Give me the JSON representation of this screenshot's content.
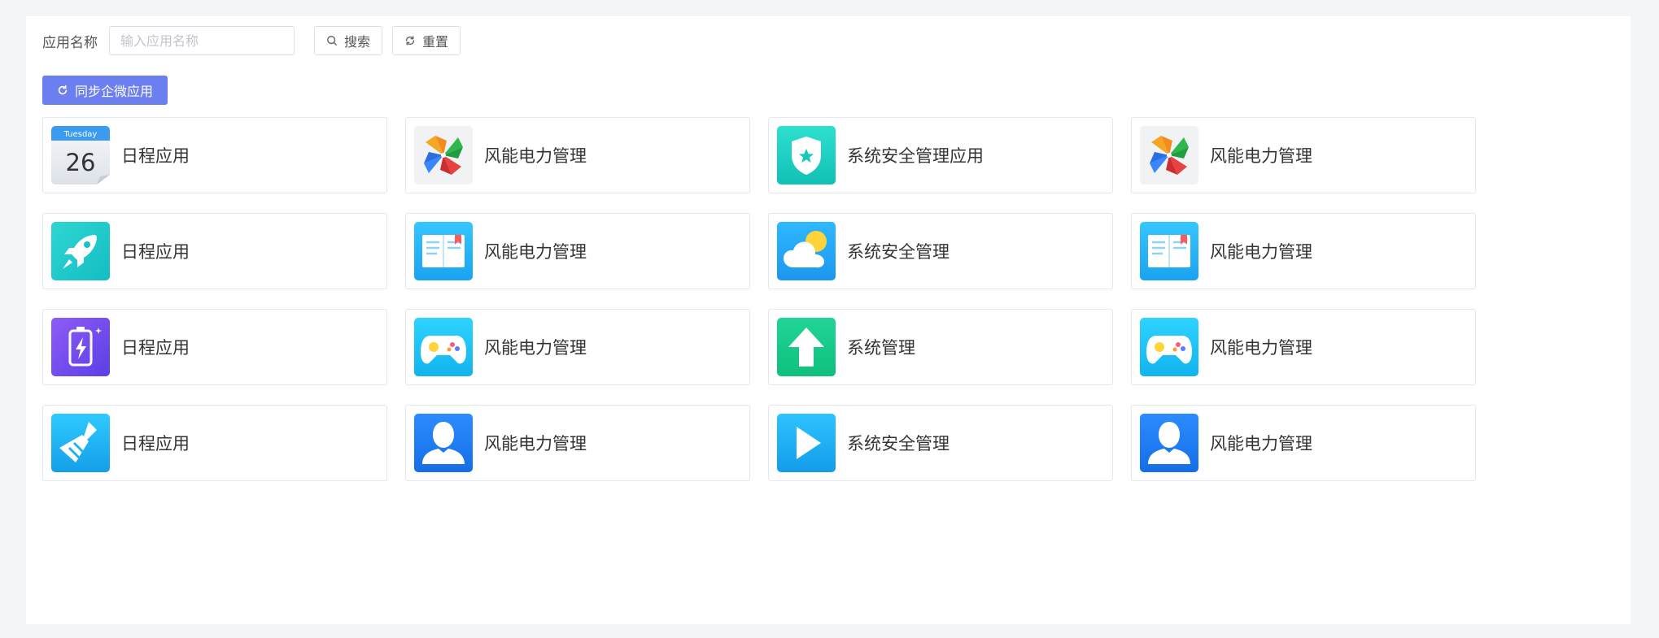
{
  "search": {
    "label": "应用名称",
    "placeholder": "输入应用名称",
    "value": "",
    "search_button": "搜索",
    "reset_button": "重置"
  },
  "sync_button": "同步企微应用",
  "calendar_icon": {
    "weekday": "Tuesday",
    "day": "26"
  },
  "apps": [
    {
      "name": "日程应用",
      "icon": "calendar-icon"
    },
    {
      "name": "风能电力管理",
      "icon": "pinwheel-icon"
    },
    {
      "name": "系统安全管理应用",
      "icon": "shield-icon"
    },
    {
      "name": "风能电力管理",
      "icon": "pinwheel-icon"
    },
    {
      "name": "日程应用",
      "icon": "rocket-icon"
    },
    {
      "name": "风能电力管理",
      "icon": "book-icon"
    },
    {
      "name": "系统安全管理",
      "icon": "weather-icon"
    },
    {
      "name": "风能电力管理",
      "icon": "book-icon"
    },
    {
      "name": "日程应用",
      "icon": "battery-icon"
    },
    {
      "name": "风能电力管理",
      "icon": "gamepad-icon"
    },
    {
      "name": "系统管理",
      "icon": "arrow-up-icon"
    },
    {
      "name": "风能电力管理",
      "icon": "gamepad-icon"
    },
    {
      "name": "日程应用",
      "icon": "broom-icon"
    },
    {
      "name": "风能电力管理",
      "icon": "user-icon"
    },
    {
      "name": "系统安全管理",
      "icon": "play-icon"
    },
    {
      "name": "风能电力管理",
      "icon": "user-icon"
    }
  ],
  "colors": {
    "primary": "#6b7ff0",
    "border": "#e4e7ed",
    "background": "#f4f5f7"
  }
}
